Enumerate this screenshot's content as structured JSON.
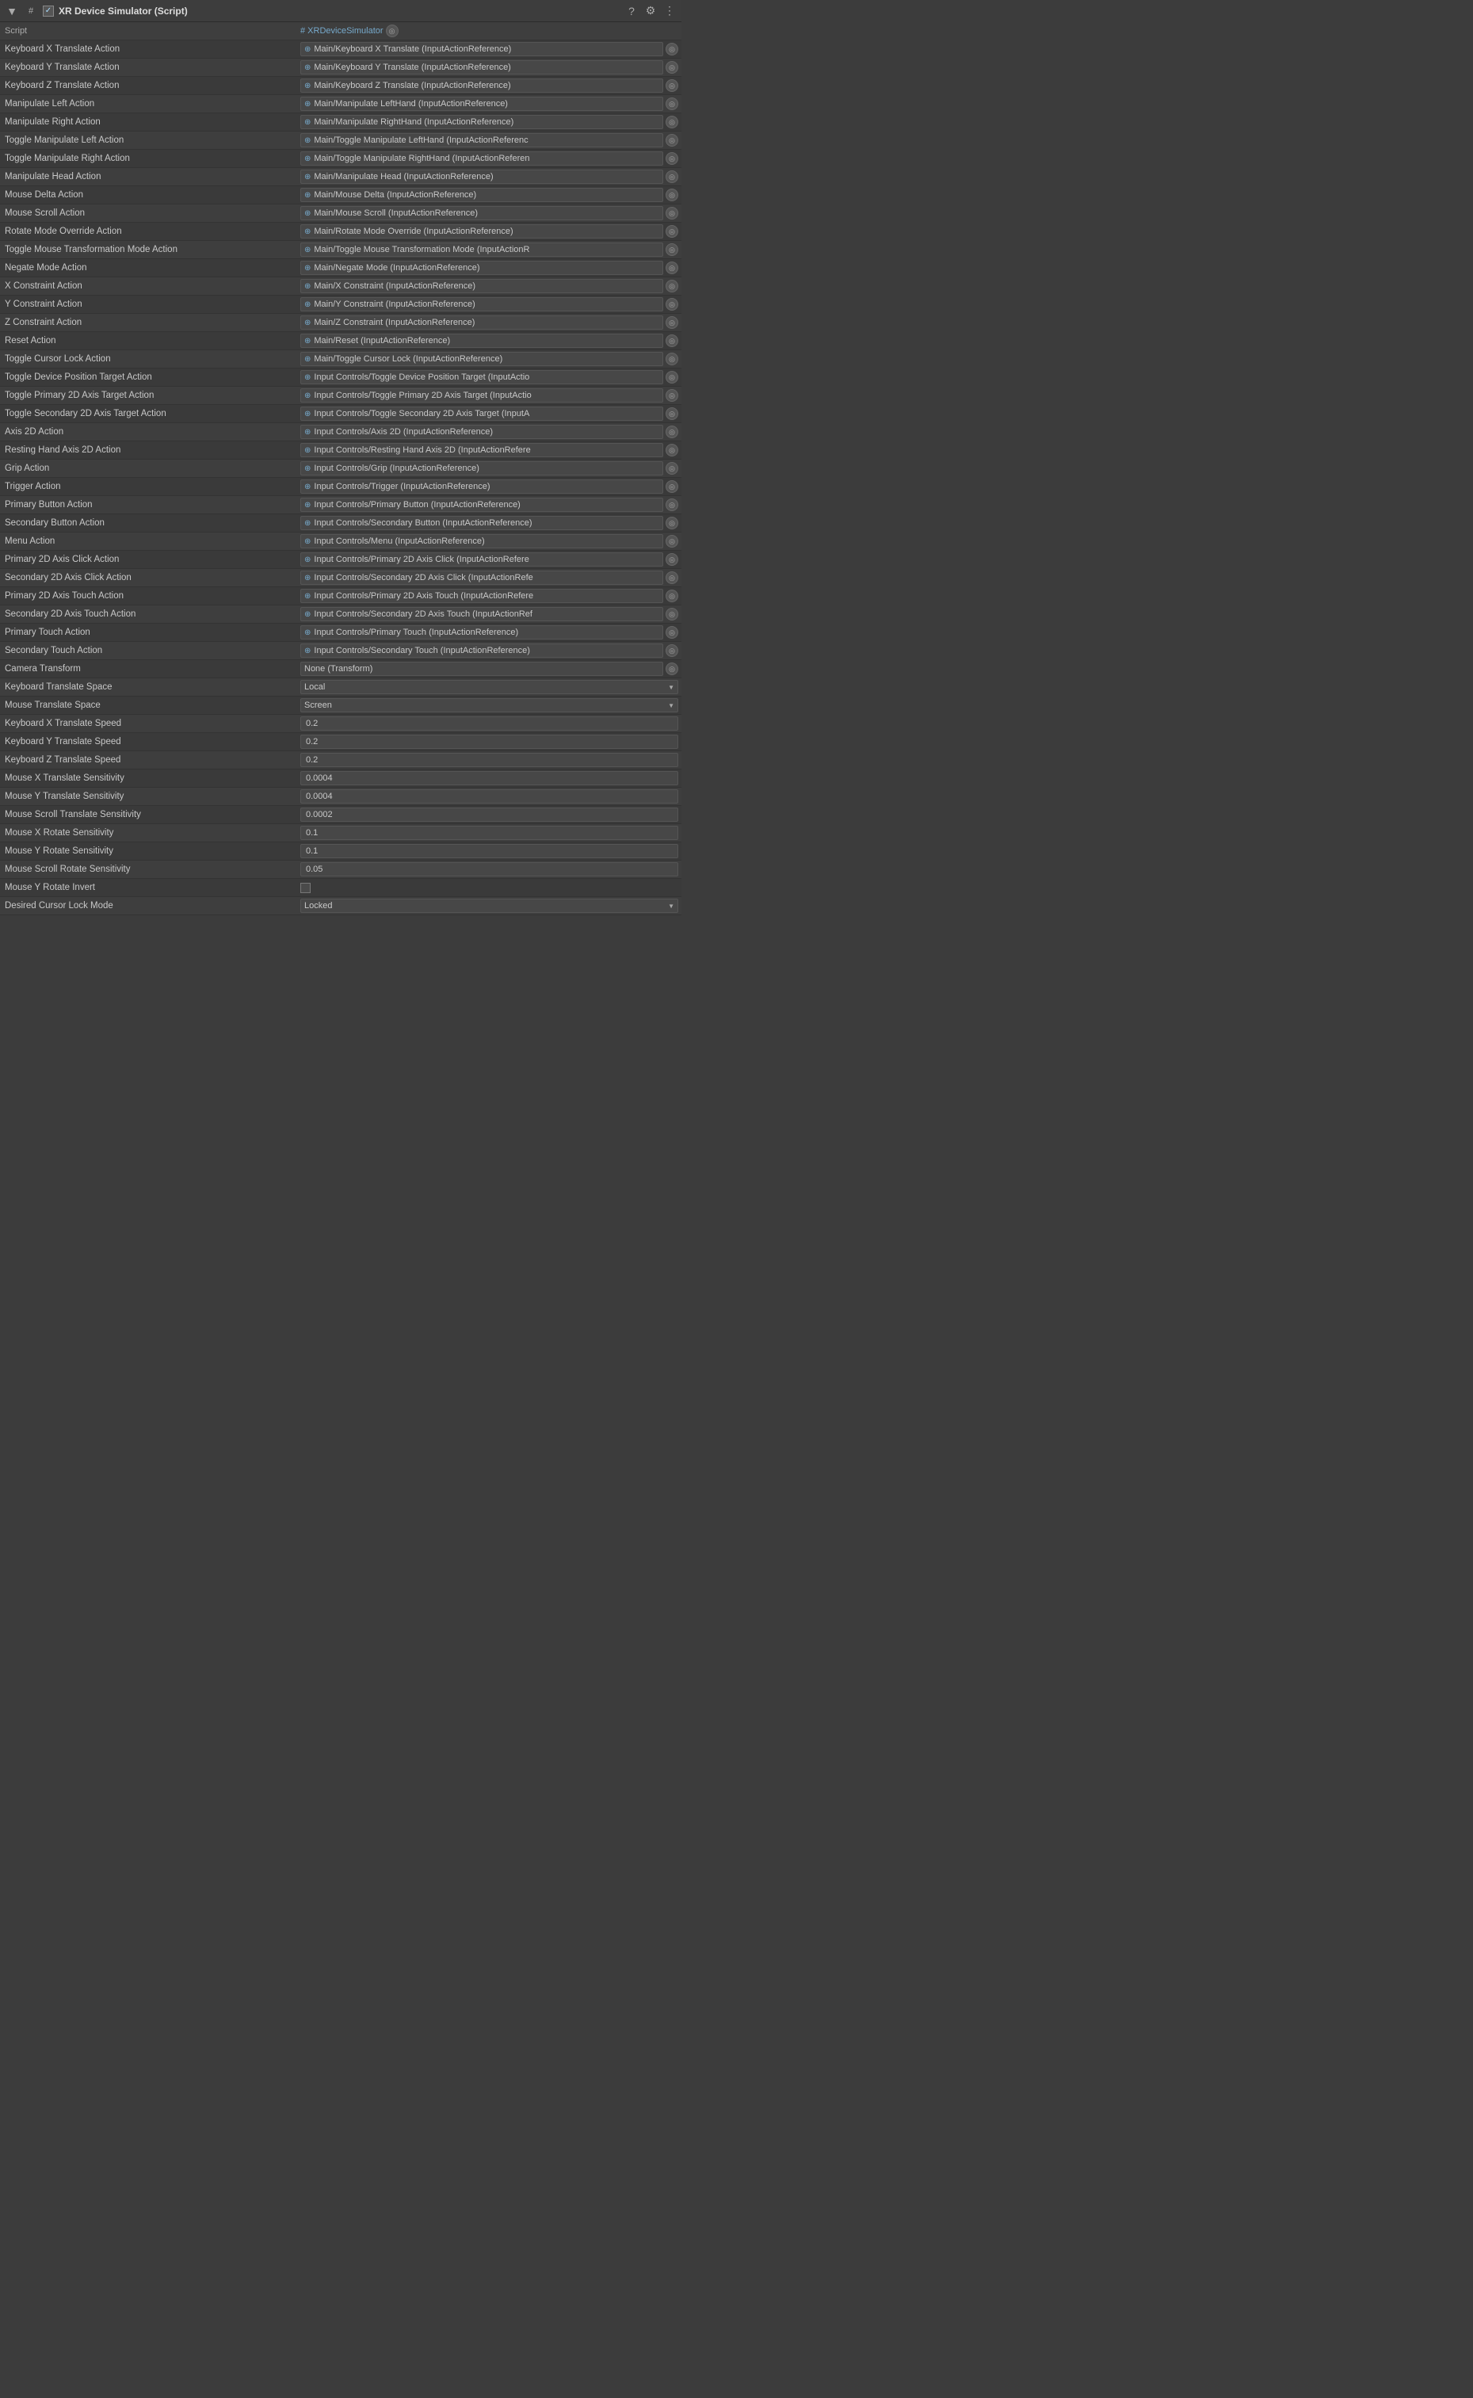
{
  "header": {
    "title": "XR Device Simulator (Script)",
    "collapse_symbol": "▼",
    "hash_symbol": "#",
    "checked": true
  },
  "rows": [
    {
      "label": "Script",
      "type": "script",
      "value": "# XRDeviceSimulator"
    },
    {
      "label": "Keyboard X Translate Action",
      "type": "action",
      "value": "Main/Keyboard X Translate (InputActionReference)"
    },
    {
      "label": "Keyboard Y Translate Action",
      "type": "action",
      "value": "Main/Keyboard Y Translate (InputActionReference)"
    },
    {
      "label": "Keyboard Z Translate Action",
      "type": "action",
      "value": "Main/Keyboard Z Translate (InputActionReference)"
    },
    {
      "label": "Manipulate Left Action",
      "type": "action",
      "value": "Main/Manipulate LeftHand (InputActionReference)"
    },
    {
      "label": "Manipulate Right Action",
      "type": "action",
      "value": "Main/Manipulate RightHand (InputActionReference)"
    },
    {
      "label": "Toggle Manipulate Left Action",
      "type": "action",
      "value": "Main/Toggle Manipulate LeftHand (InputActionReferenc"
    },
    {
      "label": "Toggle Manipulate Right Action",
      "type": "action",
      "value": "Main/Toggle Manipulate RightHand (InputActionReferen"
    },
    {
      "label": "Manipulate Head Action",
      "type": "action",
      "value": "Main/Manipulate Head (InputActionReference)"
    },
    {
      "label": "Mouse Delta Action",
      "type": "action",
      "value": "Main/Mouse Delta (InputActionReference)"
    },
    {
      "label": "Mouse Scroll Action",
      "type": "action",
      "value": "Main/Mouse Scroll (InputActionReference)"
    },
    {
      "label": "Rotate Mode Override Action",
      "type": "action",
      "value": "Main/Rotate Mode Override (InputActionReference)"
    },
    {
      "label": "Toggle Mouse Transformation Mode Action",
      "type": "action",
      "value": "Main/Toggle Mouse Transformation Mode (InputActionR"
    },
    {
      "label": "Negate Mode Action",
      "type": "action",
      "value": "Main/Negate Mode (InputActionReference)"
    },
    {
      "label": "X Constraint Action",
      "type": "action",
      "value": "Main/X Constraint (InputActionReference)"
    },
    {
      "label": "Y Constraint Action",
      "type": "action",
      "value": "Main/Y Constraint (InputActionReference)"
    },
    {
      "label": "Z Constraint Action",
      "type": "action",
      "value": "Main/Z Constraint (InputActionReference)"
    },
    {
      "label": "Reset Action",
      "type": "action",
      "value": "Main/Reset (InputActionReference)"
    },
    {
      "label": "Toggle Cursor Lock Action",
      "type": "action",
      "value": "Main/Toggle Cursor Lock (InputActionReference)"
    },
    {
      "label": "Toggle Device Position Target Action",
      "type": "action",
      "value": "Input Controls/Toggle Device Position Target (InputActio"
    },
    {
      "label": "Toggle Primary 2D Axis Target Action",
      "type": "action",
      "value": "Input Controls/Toggle Primary 2D Axis Target (InputActio"
    },
    {
      "label": "Toggle Secondary 2D Axis Target Action",
      "type": "action",
      "value": "Input Controls/Toggle Secondary 2D Axis Target (InputA"
    },
    {
      "label": "Axis 2D Action",
      "type": "action",
      "value": "Input Controls/Axis 2D (InputActionReference)"
    },
    {
      "label": "Resting Hand Axis 2D Action",
      "type": "action",
      "value": "Input Controls/Resting Hand Axis 2D (InputActionRefere"
    },
    {
      "label": "Grip Action",
      "type": "action",
      "value": "Input Controls/Grip (InputActionReference)"
    },
    {
      "label": "Trigger Action",
      "type": "action",
      "value": "Input Controls/Trigger (InputActionReference)"
    },
    {
      "label": "Primary Button Action",
      "type": "action",
      "value": "Input Controls/Primary Button (InputActionReference)"
    },
    {
      "label": "Secondary Button Action",
      "type": "action",
      "value": "Input Controls/Secondary Button (InputActionReference)"
    },
    {
      "label": "Menu Action",
      "type": "action",
      "value": "Input Controls/Menu (InputActionReference)"
    },
    {
      "label": "Primary 2D Axis Click Action",
      "type": "action",
      "value": "Input Controls/Primary 2D Axis Click (InputActionRefere"
    },
    {
      "label": "Secondary 2D Axis Click Action",
      "type": "action",
      "value": "Input Controls/Secondary 2D Axis Click (InputActionRefe"
    },
    {
      "label": "Primary 2D Axis Touch Action",
      "type": "action",
      "value": "Input Controls/Primary 2D Axis Touch (InputActionRefere"
    },
    {
      "label": "Secondary 2D Axis Touch Action",
      "type": "action",
      "value": "Input Controls/Secondary 2D Axis Touch (InputActionRef"
    },
    {
      "label": "Primary Touch Action",
      "type": "action",
      "value": "Input Controls/Primary Touch (InputActionReference)"
    },
    {
      "label": "Secondary Touch Action",
      "type": "action",
      "value": "Input Controls/Secondary Touch (InputActionReference)"
    },
    {
      "label": "Camera Transform",
      "type": "none-ref",
      "value": "None (Transform)"
    },
    {
      "label": "Keyboard Translate Space",
      "type": "select",
      "value": "Local"
    },
    {
      "label": "Mouse Translate Space",
      "type": "select",
      "value": "Screen"
    },
    {
      "label": "Keyboard X Translate Speed",
      "type": "number",
      "value": "0.2"
    },
    {
      "label": "Keyboard Y Translate Speed",
      "type": "number",
      "value": "0.2"
    },
    {
      "label": "Keyboard Z Translate Speed",
      "type": "number",
      "value": "0.2"
    },
    {
      "label": "Mouse X Translate Sensitivity",
      "type": "number",
      "value": "0.0004"
    },
    {
      "label": "Mouse Y Translate Sensitivity",
      "type": "number",
      "value": "0.0004"
    },
    {
      "label": "Mouse Scroll Translate Sensitivity",
      "type": "number",
      "value": "0.0002"
    },
    {
      "label": "Mouse X Rotate Sensitivity",
      "type": "number",
      "value": "0.1"
    },
    {
      "label": "Mouse Y Rotate Sensitivity",
      "type": "number",
      "value": "0.1"
    },
    {
      "label": "Mouse Scroll Rotate Sensitivity",
      "type": "number",
      "value": "0.05"
    },
    {
      "label": "Mouse Y Rotate Invert",
      "type": "checkbox",
      "value": false
    },
    {
      "label": "Desired Cursor Lock Mode",
      "type": "select",
      "value": "Locked"
    }
  ]
}
